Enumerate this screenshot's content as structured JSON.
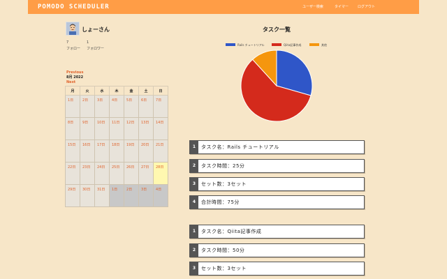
{
  "header": {
    "brand": "POMODO SCHEDULER",
    "nav": [
      "ユーザー検索",
      "タイマー",
      "ログアウト"
    ]
  },
  "profile": {
    "name": "しょーさん",
    "follow_count": "7",
    "follow_label": "フォロー",
    "follower_count": "1",
    "follower_label": "フォロワー"
  },
  "calendar": {
    "prev_label": "Previous",
    "month": "8月 2022",
    "next_label": "Next",
    "weekdays": [
      "月",
      "火",
      "水",
      "木",
      "金",
      "土",
      "日"
    ],
    "weeks": [
      [
        "1日",
        "2日",
        "3日",
        "4日",
        "5日",
        "6日",
        "7日"
      ],
      [
        "8日",
        "9日",
        "10日",
        "11日",
        "12日",
        "13日",
        "14日"
      ],
      [
        "15日",
        "16日",
        "17日",
        "18日",
        "19日",
        "20日",
        "21日"
      ],
      [
        "22日",
        "23日",
        "24日",
        "25日",
        "26日",
        "27日",
        "28日"
      ],
      [
        "29日",
        "30日",
        "31日",
        "1日",
        "2日",
        "3日",
        "4日"
      ]
    ],
    "today": "28日"
  },
  "tasks": {
    "title": "タスク一覧",
    "items": [
      {
        "num": "1",
        "text": "タスク名：Rails チュートリアル"
      },
      {
        "num": "2",
        "text": "タスク時間：25分"
      },
      {
        "num": "3",
        "text": "セット数：3セット"
      },
      {
        "num": "4",
        "text": "合計時間：75分"
      },
      {
        "num": "1",
        "text": "タスク名：Qiita記事作成"
      },
      {
        "num": "2",
        "text": "タスク時間：50分"
      },
      {
        "num": "3",
        "text": "セット数：3セット"
      }
    ]
  },
  "chart_data": {
    "type": "pie",
    "title": "",
    "labels": [
      "Rails チュートリアル",
      "Qiita記事作成",
      "其他"
    ],
    "values": [
      75,
      150,
      30
    ],
    "colors": [
      "#2f56c8",
      "#d42a1c",
      "#f5960e"
    ],
    "legend": "top"
  }
}
